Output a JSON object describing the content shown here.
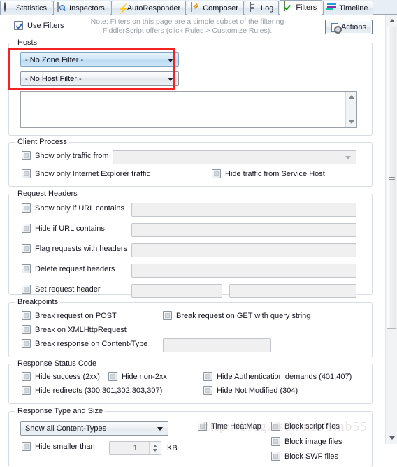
{
  "tabs": [
    {
      "label": "Statistics",
      "icon": "clock-icon",
      "active": false
    },
    {
      "label": "Inspectors",
      "icon": "magnifier-icon",
      "active": false
    },
    {
      "label": "AutoResponder",
      "icon": "bolt-icon",
      "active": false
    },
    {
      "label": "Composer",
      "icon": "pencil-icon",
      "active": false
    },
    {
      "label": "Log",
      "icon": "log-icon",
      "active": false
    },
    {
      "label": "Filters",
      "icon": "checkmark-icon",
      "active": true
    },
    {
      "label": "Timeline",
      "icon": "timeline-icon",
      "active": false
    }
  ],
  "header": {
    "use_filters_label": "Use Filters",
    "use_filters_checked": true,
    "note_line1": "Note: Filters on this page are a simple subset of the filtering",
    "note_line2": "FiddlerScript offers (click Rules > Customize Rules).",
    "actions_label": "Actions"
  },
  "hosts": {
    "title": "Hosts",
    "zone_filter_value": "- No Zone Filter -",
    "host_filter_value": "- No Host Filter -",
    "host_list_value": ""
  },
  "client_process": {
    "title": "Client Process",
    "show_only_traffic_from_label": "Show only traffic from",
    "process_value": "",
    "show_only_ie_label": "Show only Internet Explorer traffic",
    "hide_service_host_label": "Hide traffic from Service Host"
  },
  "request_headers": {
    "title": "Request Headers",
    "rows": [
      {
        "label": "Show only if URL contains",
        "value": ""
      },
      {
        "label": "Hide if URL contains",
        "value": ""
      },
      {
        "label": "Flag requests with headers",
        "value": ""
      },
      {
        "label": "Delete request headers",
        "value": ""
      }
    ],
    "set_request_header_label": "Set request header",
    "set_header_name": "",
    "set_header_value": ""
  },
  "breakpoints": {
    "title": "Breakpoints",
    "break_post_label": "Break request on POST",
    "break_get_label": "Break request on GET with query string",
    "break_xhr_label": "Break on XMLHttpRequest",
    "break_response_label": "Break response on Content-Type",
    "break_response_value": ""
  },
  "response_status": {
    "title": "Response Status Code",
    "hide_success_label": "Hide success (2xx)",
    "hide_non2xx_label": "Hide non-2xx",
    "hide_auth_label": "Hide Authentication demands (401,407)",
    "hide_redirects_label": "Hide redirects (300,301,302,303,307)",
    "hide_not_modified_label": "Hide Not Modified (304)"
  },
  "response_type": {
    "title": "Response Type and Size",
    "content_type_value": "Show all Content-Types",
    "hide_smaller_label": "Hide smaller than",
    "hide_smaller_value": "1",
    "hide_smaller_unit": "KB",
    "time_heatmap_label": "Time HeatMap",
    "block_script_label": "Block script files",
    "block_image_label": "Block image files",
    "block_swf_label": "Block SWF files"
  },
  "annotation": {
    "highlight_color": "#f42222"
  },
  "watermark": {
    "text": "http://blog.csdn.net/1mb55"
  }
}
